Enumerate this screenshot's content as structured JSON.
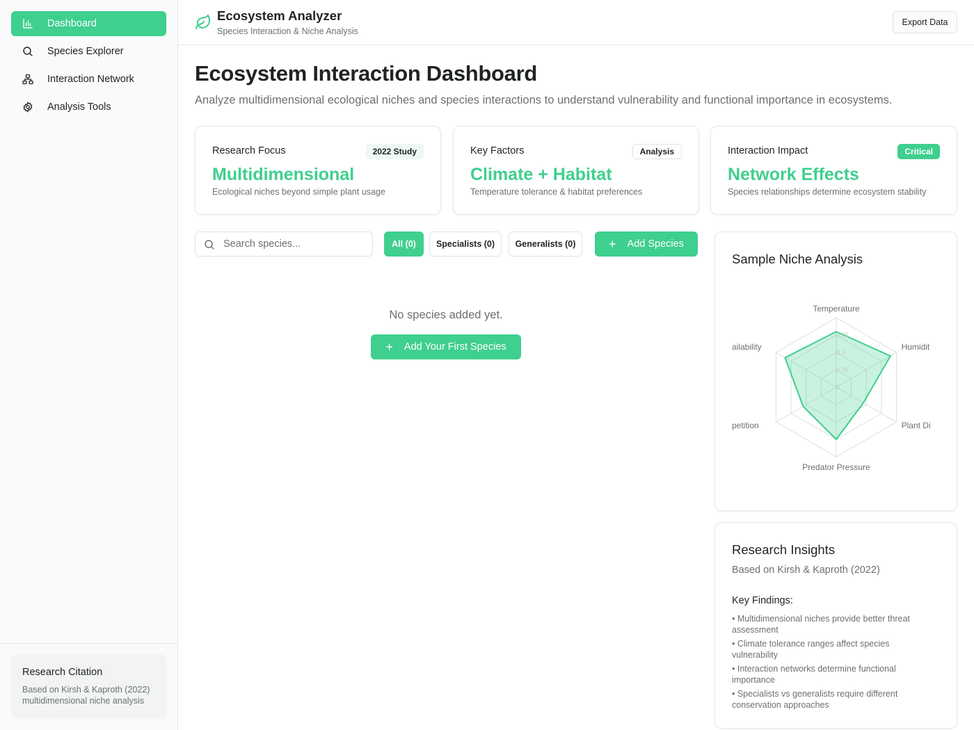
{
  "sidebar": {
    "items": [
      {
        "label": "Dashboard",
        "icon": "bar-chart-icon",
        "active": true
      },
      {
        "label": "Species Explorer",
        "icon": "search-icon",
        "active": false
      },
      {
        "label": "Interaction Network",
        "icon": "network-icon",
        "active": false
      },
      {
        "label": "Analysis Tools",
        "icon": "gear-icon",
        "active": false
      }
    ],
    "citation": {
      "title": "Research Citation",
      "text": "Based on Kirsh & Kaproth (2022) multidimensional niche analysis"
    }
  },
  "header": {
    "icon": "leaf-icon",
    "title": "Ecosystem Analyzer",
    "subtitle": "Species Interaction & Niche Analysis",
    "export_label": "Export Data"
  },
  "main": {
    "title": "Ecosystem Interaction Dashboard",
    "description": "Analyze multidimensional ecological niches and species interactions to understand vulnerability and functional importance in ecosystems.",
    "cards": [
      {
        "label": "Research Focus",
        "badge": "2022 Study",
        "headline": "Multidimensional",
        "sub": "Ecological niches beyond simple plant usage"
      },
      {
        "label": "Key Factors",
        "badge": "Analysis",
        "headline": "Climate + Habitat",
        "sub": "Temperature tolerance & habitat preferences"
      },
      {
        "label": "Interaction Impact",
        "badge": "Critical",
        "headline": "Network Effects",
        "sub": "Species relationships determine ecosystem stability"
      }
    ],
    "search": {
      "placeholder": "Search species..."
    },
    "filters": [
      {
        "label": "All (0)",
        "active": true
      },
      {
        "label": "Specialists (0)",
        "active": false
      },
      {
        "label": "Generalists (0)",
        "active": false
      }
    ],
    "add_species_label": "Add Species",
    "empty_text": "No species added yet.",
    "add_first_label": "Add Your First Species"
  },
  "niche_panel": {
    "title": "Sample Niche Analysis"
  },
  "insights": {
    "title": "Research Insights",
    "subtitle": "Based on Kirsh & Kaproth (2022)",
    "key_findings_label": "Key Findings:",
    "findings": [
      "• Multidimensional niches provide better threat assessment",
      "• Climate tolerance ranges affect species vulnerability",
      "• Interaction networks determine functional importance",
      "• Specialists vs generalists require different conservation approaches"
    ]
  },
  "colors": {
    "accent": "#3fcf8e",
    "text": "#1f2321",
    "muted": "#6b716e",
    "border": "#e6e8e7"
  },
  "chart_data": {
    "type": "radar",
    "axes": [
      "Temperature",
      "Humidity",
      "Plant Diversity",
      "Predator Pressure",
      "Competition",
      "Food Availability"
    ],
    "axis_labels_visible": [
      "Temperature",
      "Humidit",
      "Plant Di",
      "Predator Pressure",
      "petition",
      "ailability"
    ],
    "ticks": [
      "0",
      "0.25",
      "0.5",
      "0.75"
    ],
    "range": [
      0,
      1
    ],
    "series": [
      {
        "values": [
          0.8,
          0.9,
          0.45,
          0.75,
          0.55,
          0.85
        ],
        "color": "#3fcf8e"
      }
    ]
  }
}
